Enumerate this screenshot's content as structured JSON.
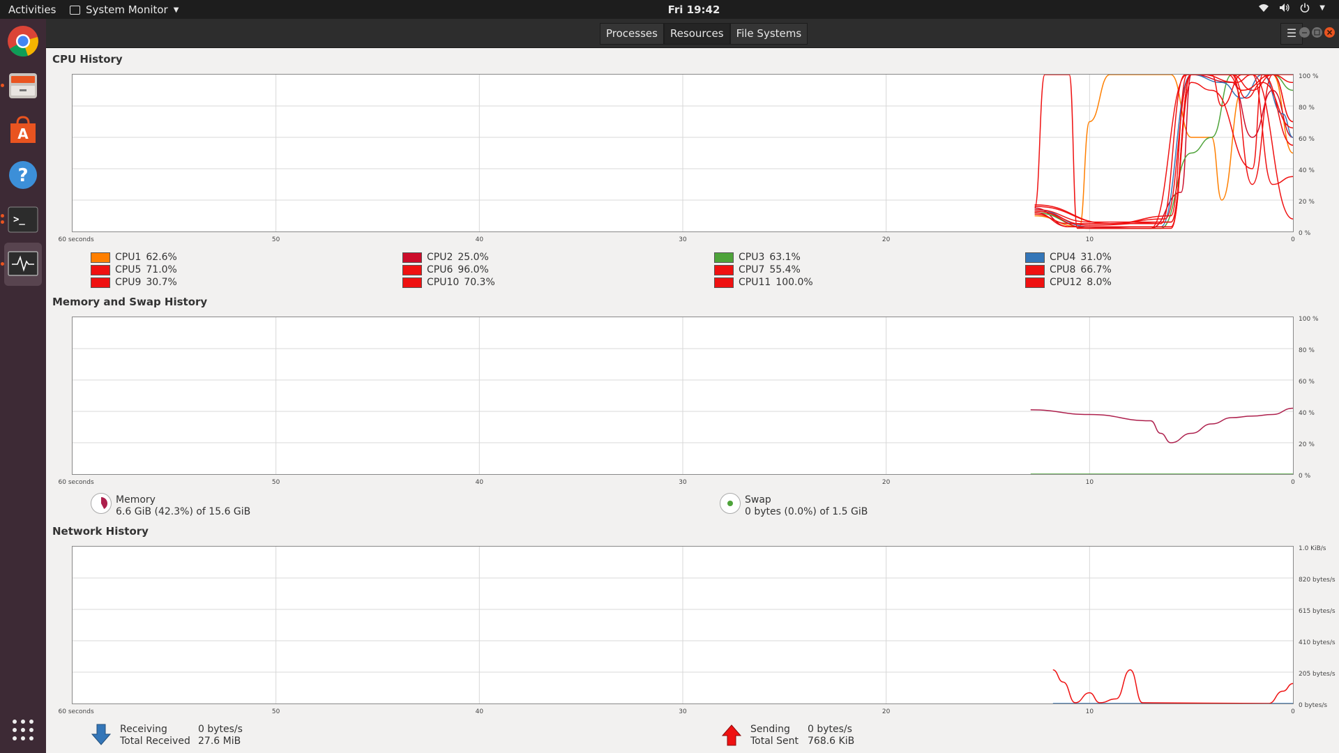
{
  "topbar": {
    "activities": "Activities",
    "app_menu": "System Monitor",
    "clock": "Fri 19:42"
  },
  "dock": {
    "items": [
      "chrome-icon",
      "files-icon",
      "software-icon",
      "help-icon",
      "terminal-icon",
      "system-monitor-icon"
    ],
    "apps_grid": "show-applications-icon"
  },
  "header": {
    "tabs": [
      "Processes",
      "Resources",
      "File Systems"
    ],
    "active_tab": "Resources"
  },
  "cpu": {
    "title": "CPU History",
    "legend": [
      {
        "label": "CPU1",
        "value": "62.6%",
        "color": "#ff7f00"
      },
      {
        "label": "CPU2",
        "value": "25.0%",
        "color": "#cc0c2a"
      },
      {
        "label": "CPU3",
        "value": "63.1%",
        "color": "#4ea33a"
      },
      {
        "label": "CPU4",
        "value": "31.0%",
        "color": "#3476b8"
      },
      {
        "label": "CPU5",
        "value": "71.0%",
        "color": "#ef1111"
      },
      {
        "label": "CPU6",
        "value": "96.0%",
        "color": "#ef1111"
      },
      {
        "label": "CPU7",
        "value": "55.4%",
        "color": "#ef1111"
      },
      {
        "label": "CPU8",
        "value": "66.7%",
        "color": "#ef1111"
      },
      {
        "label": "CPU9",
        "value": "30.7%",
        "color": "#ef1111"
      },
      {
        "label": "CPU10",
        "value": "70.3%",
        "color": "#ef1111"
      },
      {
        "label": "CPU11",
        "value": "100.0%",
        "color": "#ef1111"
      },
      {
        "label": "CPU12",
        "value": "8.0%",
        "color": "#ef1111"
      }
    ],
    "y_ticks": [
      "100 %",
      "80 %",
      "60 %",
      "40 %",
      "20 %",
      "0 %"
    ]
  },
  "x_ticks": [
    "60 seconds",
    "50",
    "40",
    "30",
    "20",
    "10",
    "0"
  ],
  "memory": {
    "title": "Memory and Swap History",
    "y_ticks": [
      "100 %",
      "80 %",
      "60 %",
      "40 %",
      "20 %",
      "0 %"
    ],
    "memory_label": "Memory",
    "memory_value": "6.6 GiB (42.3%) of 15.6 GiB",
    "memory_color": "#ad1f4c",
    "swap_label": "Swap",
    "swap_value": "0 bytes (0.0%) of 1.5 GiB",
    "swap_color": "#4ea33a"
  },
  "network": {
    "title": "Network History",
    "y_ticks": [
      "1.0 KiB/s",
      "820 bytes/s",
      "615 bytes/s",
      "410 bytes/s",
      "205 bytes/s",
      "0 bytes/s"
    ],
    "receiving_label": "Receiving",
    "receiving_value": "0 bytes/s",
    "total_received_label": "Total Received",
    "total_received_value": "27.6 MiB",
    "sending_label": "Sending",
    "sending_value": "0 bytes/s",
    "total_sent_label": "Total Sent",
    "total_sent_value": "768.6 KiB",
    "receiving_color": "#3476b8",
    "sending_color": "#ef1111"
  },
  "chart_data": [
    {
      "type": "line",
      "title": "CPU History",
      "x_unit": "seconds ago",
      "xlim": [
        60,
        0
      ],
      "ylim": [
        0,
        100
      ],
      "series": [
        {
          "name": "CPU1",
          "color": "#ff7f00",
          "points": [
            [
              12.7,
              10
            ],
            [
              10.5,
              3
            ],
            [
              10,
              70
            ],
            [
              9,
              100
            ],
            [
              6,
              100
            ],
            [
              5,
              60
            ],
            [
              4,
              60
            ],
            [
              3.5,
              20
            ],
            [
              2.5,
              90
            ],
            [
              1,
              100
            ],
            [
              0,
              50
            ]
          ]
        },
        {
          "name": "CPU2",
          "color": "#cc0c2a",
          "points": [
            [
              12.7,
              15
            ],
            [
              11,
              3
            ],
            [
              7,
              2
            ],
            [
              5.5,
              25
            ],
            [
              5,
              100
            ],
            [
              3,
              95
            ],
            [
              2,
              60
            ],
            [
              1,
              90
            ],
            [
              0,
              60
            ]
          ]
        },
        {
          "name": "CPU3",
          "color": "#4ea33a",
          "points": [
            [
              12.7,
              12
            ],
            [
              10,
              2
            ],
            [
              6.5,
              2
            ],
            [
              5,
              50
            ],
            [
              4,
              60
            ],
            [
              3,
              100
            ],
            [
              1,
              100
            ],
            [
              0,
              90
            ]
          ]
        },
        {
          "name": "CPU4",
          "color": "#3476b8",
          "points": [
            [
              12.7,
              14
            ],
            [
              10,
              3
            ],
            [
              6.5,
              3
            ],
            [
              5,
              100
            ],
            [
              3.5,
              95
            ],
            [
              2.5,
              85
            ],
            [
              1.5,
              100
            ],
            [
              0.5,
              75
            ],
            [
              0,
              60
            ]
          ]
        },
        {
          "name": "CPU5",
          "color": "#ef1111",
          "points": [
            [
              12.7,
              15
            ],
            [
              12.2,
              100
            ],
            [
              11,
              100
            ],
            [
              10.6,
              2
            ],
            [
              7,
              2
            ],
            [
              5.2,
              100
            ],
            [
              3,
              100
            ],
            [
              2,
              30
            ],
            [
              1,
              100
            ],
            [
              0,
              70
            ]
          ]
        },
        {
          "name": "CPU6",
          "color": "#ef1111",
          "points": [
            [
              12.7,
              13
            ],
            [
              10,
              4
            ],
            [
              6,
              6
            ],
            [
              5,
              100
            ],
            [
              4,
              100
            ],
            [
              3.5,
              80
            ],
            [
              2.5,
              100
            ],
            [
              1,
              100
            ],
            [
              0,
              95
            ]
          ]
        },
        {
          "name": "CPU7",
          "color": "#ef1111",
          "points": [
            [
              12.7,
              12
            ],
            [
              11,
              3
            ],
            [
              6,
              3
            ],
            [
              5,
              95
            ],
            [
              4,
              90
            ],
            [
              2,
              40
            ],
            [
              1.5,
              100
            ],
            [
              0,
              55
            ]
          ]
        },
        {
          "name": "CPU8",
          "color": "#ef1111",
          "points": [
            [
              12.7,
              16
            ],
            [
              9,
              5
            ],
            [
              6.3,
              8
            ],
            [
              5,
              100
            ],
            [
              3,
              100
            ],
            [
              2.3,
              85
            ],
            [
              1.5,
              95
            ],
            [
              0,
              66
            ]
          ]
        },
        {
          "name": "CPU9",
          "color": "#ef1111",
          "points": [
            [
              12.7,
              14
            ],
            [
              10,
              6
            ],
            [
              6,
              6
            ],
            [
              5,
              100
            ],
            [
              2,
              100
            ],
            [
              1,
              30
            ],
            [
              0,
              35
            ]
          ]
        },
        {
          "name": "CPU10",
          "color": "#ef1111",
          "points": [
            [
              12.7,
              11
            ],
            [
              11,
              5
            ],
            [
              6.5,
              5
            ],
            [
              5.3,
              100
            ],
            [
              3.2,
              100
            ],
            [
              2.5,
              90
            ],
            [
              1,
              100
            ],
            [
              0,
              70
            ]
          ]
        },
        {
          "name": "CPU11",
          "color": "#ef1111",
          "points": [
            [
              12.7,
              13
            ],
            [
              10,
              2
            ],
            [
              6,
              2
            ],
            [
              5,
              100
            ],
            [
              3,
              100
            ],
            [
              2,
              90
            ],
            [
              1,
              100
            ],
            [
              0,
              100
            ]
          ]
        },
        {
          "name": "CPU12",
          "color": "#ef1111",
          "points": [
            [
              12.7,
              17
            ],
            [
              9,
              5
            ],
            [
              6,
              10
            ],
            [
              5.2,
              100
            ],
            [
              4.5,
              100
            ],
            [
              2.8,
              95
            ],
            [
              2,
              100
            ],
            [
              0,
              8
            ]
          ]
        }
      ]
    },
    {
      "type": "line",
      "title": "Memory and Swap History",
      "x_unit": "seconds ago",
      "xlim": [
        60,
        0
      ],
      "ylim": [
        0,
        100
      ],
      "series": [
        {
          "name": "Memory",
          "color": "#ad1f4c",
          "points": [
            [
              12.9,
              41
            ],
            [
              10,
              38
            ],
            [
              7,
              34
            ],
            [
              6.5,
              26
            ],
            [
              6,
              20
            ],
            [
              5,
              26
            ],
            [
              4,
              32
            ],
            [
              3,
              36
            ],
            [
              2,
              37
            ],
            [
              1,
              38
            ],
            [
              0,
              42
            ]
          ]
        },
        {
          "name": "Swap",
          "color": "#4ea33a",
          "points": [
            [
              12.9,
              0
            ],
            [
              0,
              0
            ]
          ]
        }
      ]
    },
    {
      "type": "line",
      "title": "Network History",
      "x_unit": "seconds ago",
      "xlim": [
        60,
        0
      ],
      "y_unit": "bytes/s",
      "ylim": [
        0,
        1024
      ],
      "series": [
        {
          "name": "Receiving",
          "color": "#3476b8",
          "points": [
            [
              11.8,
              0
            ],
            [
              0,
              0
            ]
          ]
        },
        {
          "name": "Sending",
          "color": "#ef1111",
          "points": [
            [
              11.8,
              220
            ],
            [
              11.3,
              140
            ],
            [
              10.7,
              5
            ],
            [
              10,
              70
            ],
            [
              9.5,
              5
            ],
            [
              8.7,
              30
            ],
            [
              8,
              220
            ],
            [
              7.4,
              5
            ],
            [
              1.2,
              0
            ],
            [
              0.5,
              80
            ],
            [
              0,
              130
            ]
          ]
        }
      ]
    }
  ]
}
